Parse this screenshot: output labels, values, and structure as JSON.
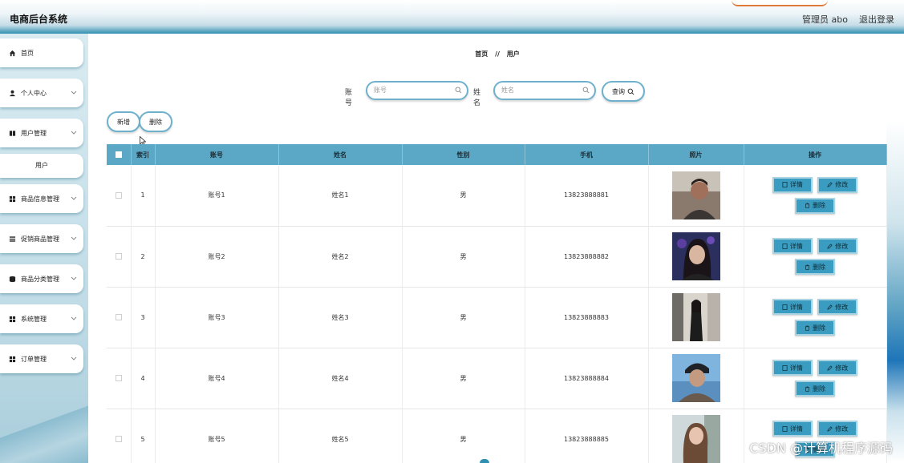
{
  "header": {
    "title": "电商后台系统",
    "admin_label": "管理员 abo",
    "logout_label": "退出登录"
  },
  "sidebar": {
    "items": [
      {
        "label": "首页",
        "icon": "home-icon"
      },
      {
        "label": "个人中心",
        "icon": "user-icon"
      },
      {
        "label": "用户管理",
        "icon": "book-icon"
      },
      {
        "label": "商品信息管理",
        "icon": "grid-icon"
      },
      {
        "label": "促销商品管理",
        "icon": "list-icon"
      },
      {
        "label": "商品分类管理",
        "icon": "database-icon"
      },
      {
        "label": "系统管理",
        "icon": "grid-icon"
      },
      {
        "label": "订单管理",
        "icon": "grid-icon"
      }
    ],
    "sub_item": "用户"
  },
  "breadcrumb": {
    "home": "首页",
    "separator": "//",
    "current": "用户"
  },
  "search": {
    "account_label": "账号",
    "account_placeholder": "账号",
    "name_label": "姓名",
    "name_placeholder": "姓名",
    "query_label": "查询"
  },
  "actions": {
    "add_label": "新增",
    "delete_label": "删除"
  },
  "table": {
    "headers": [
      "索引",
      "账号",
      "姓名",
      "性别",
      "手机",
      "照片",
      "操作"
    ],
    "rows": [
      {
        "index": "1",
        "account": "账号1",
        "name": "姓名1",
        "gender": "男",
        "phone": "13823888881"
      },
      {
        "index": "2",
        "account": "账号2",
        "name": "姓名2",
        "gender": "男",
        "phone": "13823888882"
      },
      {
        "index": "3",
        "account": "账号3",
        "name": "姓名3",
        "gender": "男",
        "phone": "13823888883"
      },
      {
        "index": "4",
        "account": "账号4",
        "name": "姓名4",
        "gender": "男",
        "phone": "13823888884"
      },
      {
        "index": "5",
        "account": "账号5",
        "name": "姓名5",
        "gender": "男",
        "phone": "13823888885"
      }
    ],
    "ops": {
      "detail_label": "详情",
      "edit_label": "修改",
      "delete_label": "删除"
    }
  },
  "watermark": "CSDN @计算机程序源码",
  "colors": {
    "accent": "#5aa8c6",
    "button": "#3a9cc0",
    "border": "#6eb1cc"
  }
}
